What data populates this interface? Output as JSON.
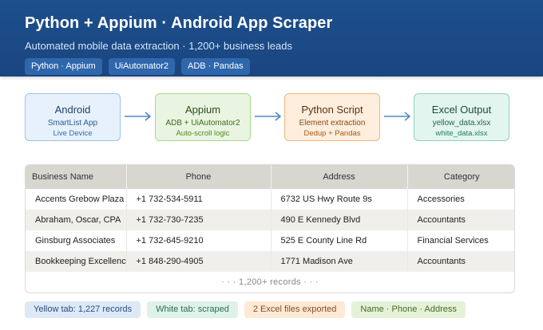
{
  "header": {
    "title": "Python + Appium · Android App Scraper",
    "subtitle": "Automated mobile data extraction · 1,200+ business leads",
    "tags": [
      "Python · Appium",
      "UiAutomator2",
      "ADB · Pandas"
    ]
  },
  "flow": [
    {
      "title": "Android",
      "line1": "SmartList App",
      "line2": "Live Device",
      "bg": "#e7f1fb",
      "border": "#9cc3e8",
      "title_color": "#1f3f66",
      "line1_color": "#2a5d98",
      "line2_color": "#2f6fb5"
    },
    {
      "title": "Appium",
      "line1": "ADB + UiAutomator2",
      "line2": "Auto-scroll logic",
      "bg": "#e9f5e1",
      "border": "#a9d58c",
      "title_color": "#2d4b17",
      "line1_color": "#3e6b1d",
      "line2_color": "#4d8a23"
    },
    {
      "title": "Python Script",
      "line1": "Element extraction",
      "line2": "Dedup + Pandas",
      "bg": "#fdeedd",
      "border": "#f2b87c",
      "title_color": "#5a3212",
      "line1_color": "#8a4a12",
      "line2_color": "#a75a16"
    },
    {
      "title": "Excel Output",
      "line1": "yellow_data.xlsx",
      "line2": "white_data.xlsx",
      "bg": "#e3f5ef",
      "border": "#8fd1b8",
      "title_color": "#1a4a39",
      "line1_color": "#1e6850",
      "line2_color": "#1f7d5f"
    }
  ],
  "table": {
    "headers": [
      "Business Name",
      "Phone",
      "Address",
      "Category"
    ],
    "rows": [
      [
        "Accents Grebow Plaza",
        "+1 732-534-5911",
        "6732 US Hwy Route 9s",
        "Accessories"
      ],
      [
        "Abraham, Oscar, CPA",
        "+1 732-730-7235",
        "490 E Kennedy Blvd",
        "Accountants"
      ],
      [
        "Ginsburg Associates",
        "+1 732-645-9210",
        "525 E County Line Rd",
        "Financial Services"
      ],
      [
        "Bookkeeping Excellence",
        "+1 848-290-4905",
        "1771 Madison Ave",
        "Accountants"
      ]
    ],
    "more": "· · · 1,200+ records · · ·"
  },
  "footer": [
    {
      "label": "Yellow tab: 1,227 records",
      "bg": "#dde9f7",
      "color": "#2a4f7e"
    },
    {
      "label": "White tab: scraped",
      "bg": "#dff2ea",
      "color": "#2c6e55"
    },
    {
      "label": "2 Excel files exported",
      "bg": "#fde9d6",
      "color": "#8a4d1a"
    },
    {
      "label": "Name · Phone · Address",
      "bg": "#e5f2d8",
      "color": "#456b22"
    }
  ],
  "colors": {
    "header_bg": "#1d4f8c",
    "arrow": "#4a86c8"
  }
}
